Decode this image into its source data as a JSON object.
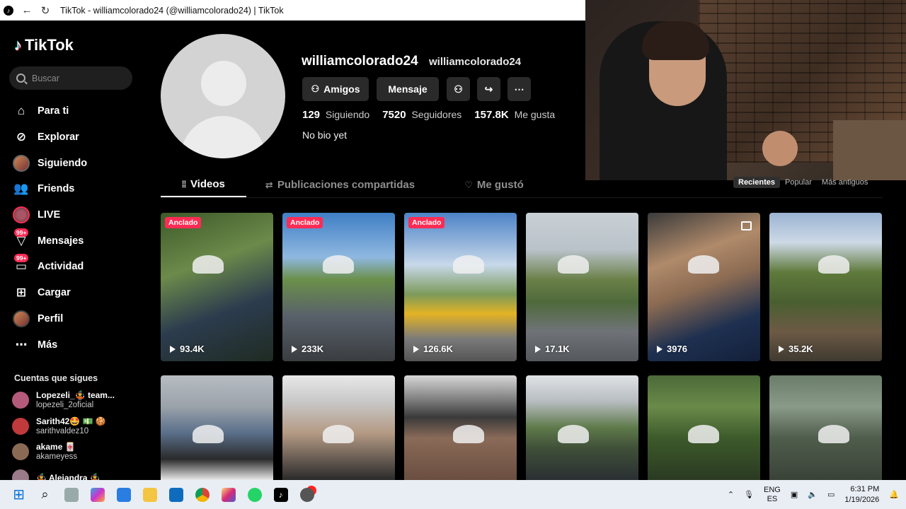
{
  "window": {
    "title": "TikTok - williamcolorado24 (@williamcolorado24) | TikTok"
  },
  "sidebar": {
    "logo_text": "TikTok",
    "search_placeholder": "Buscar",
    "nav": [
      {
        "label": "Para ti",
        "icon": "home-icon"
      },
      {
        "label": "Explorar",
        "icon": "compass-icon"
      },
      {
        "label": "Siguiendo",
        "icon": "following-avatar-icon"
      },
      {
        "label": "Friends",
        "icon": "friends-icon"
      },
      {
        "label": "LIVE",
        "icon": "live-icon"
      },
      {
        "label": "Mensajes",
        "icon": "messages-icon",
        "badge": "99+"
      },
      {
        "label": "Actividad",
        "icon": "activity-icon",
        "badge": "99+"
      },
      {
        "label": "Cargar",
        "icon": "upload-icon"
      },
      {
        "label": "Perfil",
        "icon": "profile-avatar-icon"
      },
      {
        "label": "Más",
        "icon": "more-icon"
      }
    ],
    "following_title": "Cuentas que sigues",
    "following": [
      {
        "name": "Lopezeli_🤹 team...",
        "user": "lopezeli_2oficial",
        "color": "#b55a7a"
      },
      {
        "name": "Sarith42🤩 💵 🍪",
        "user": "sarithvaldez10",
        "color": "#c0393b"
      },
      {
        "name": "akame 🀄",
        "user": "akameyess",
        "color": "#8b6a55"
      },
      {
        "name": "🤹 Alejandra 🤹",
        "user": "",
        "color": "#9a7a88"
      }
    ]
  },
  "profile": {
    "username": "williamcolorado24",
    "nickname": "williamcolorado24",
    "friends_button": "Amigos",
    "message_button": "Mensaje",
    "following_count": "129",
    "following_label": "Siguiendo",
    "followers_count": "7520",
    "followers_label": "Seguidores",
    "likes_count": "157.8K",
    "likes_label": "Me gusta",
    "bio": "No bio yet"
  },
  "tabs": {
    "videos": "Videos",
    "shared": "Publicaciones compartidas",
    "liked": "Me gustó"
  },
  "sort": {
    "recent": "Recientes",
    "popular": "Popular",
    "oldest": "Más antiguos"
  },
  "videos": [
    {
      "pinned": "Anclado",
      "views": "93.4K",
      "bg": "linear-gradient(160deg,#3d5a2a 0%,#6c8a4a 35%,#2c3c4e 65%,#1f2b22 100%)"
    },
    {
      "pinned": "Anclado",
      "views": "233K",
      "bg": "linear-gradient(180deg,#3f7fc5 0%,#8fb8e0 30%,#6b8f4a 45%,#58606a 70%,#3a3d40 100%)"
    },
    {
      "pinned": "Anclado",
      "views": "126.6K",
      "bg": "linear-gradient(180deg,#4d83c7 0%,#c7d8ea 35%,#7c9a5a 55%,#e3b325 68%,#7a7a7a 85%,#555 100%)"
    },
    {
      "pinned": "",
      "views": "17.1K",
      "bg": "linear-gradient(180deg,#c9d0d6 0%,#b9c2c9 25%,#6a8048 45%,#4f6a3a 60%,#6f7378 80%,#55595d 100%)"
    },
    {
      "pinned": "",
      "views": "3976",
      "photo": true,
      "bg": "linear-gradient(160deg,#3b3b3b 0%,#b08a6a 30%,#8a6a52 50%,#1e3050 75%,#13203a 100%)"
    },
    {
      "pinned": "",
      "views": "35.2K",
      "bg": "linear-gradient(180deg,#9ab4d2 0%,#cdd9e6 20%,#5f7a3c 40%,#4a5f30 60%,#6c5a45 80%,#3f3a30 100%)"
    },
    {
      "pinned": "",
      "views": "",
      "bg": "linear-gradient(180deg,#b7bcc2 0%,#9aa2aa 30%,#5a6f8a 55%,#2a2a2a 80%,#e8e8e8 100%)"
    },
    {
      "pinned": "",
      "views": "",
      "bg": "linear-gradient(180deg,#e8e8e8 0%,#c8c8c8 25%,#b49a84 55%,#2a2a2a 100%)"
    },
    {
      "pinned": "",
      "views": "",
      "bg": "linear-gradient(180deg,#d7d7d7 0%,#777 25%,#3a3a3a 40%,#8a6a58 60%,#6a4e40 100%)"
    },
    {
      "pinned": "",
      "views": "",
      "bg": "linear-gradient(180deg,#dfe3e6 0%,#b7bcc0 25%,#5e7a4a 50%,#3f4f38 70%,#2a2f33 100%)"
    },
    {
      "pinned": "",
      "views": "",
      "bg": "linear-gradient(180deg,#4b6a38 0%,#6a8a4a 30%,#3d5a2a 60%,#2a3a22 100%)"
    },
    {
      "pinned": "",
      "views": "",
      "bg": "linear-gradient(180deg,#6a7d6a 0%,#8a9a88 30%,#4f5d4c 60%,#3a4238 100%)"
    }
  ],
  "taskbar": {
    "lang_top": "ENG",
    "lang_bottom": "ES",
    "time": "6:31 PM",
    "date": "1/19/2026"
  },
  "colors": {
    "accent": "#fe2c55",
    "background": "#000000",
    "button": "#2a2a2a"
  }
}
